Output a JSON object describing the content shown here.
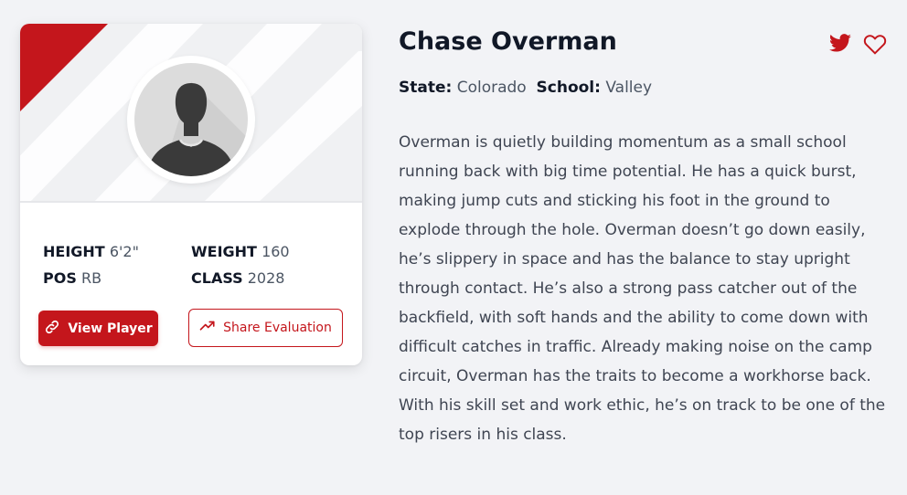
{
  "player": {
    "name": "Chase Overman",
    "state_label": "State:",
    "state": "Colorado",
    "school_label": "School:",
    "school": "Valley",
    "bio": "Overman is quietly building momentum as a small school running back with big time potential. He has a quick burst, making jump cuts and sticking his foot in the ground to explode through the hole. Overman doesn’t go down easily, he’s slippery in space and has the balance to stay upright through contact. He’s also a strong pass catcher out of the backfield, with soft hands and the ability to come down with difficult catches in traffic. Already making noise on the camp circuit, Overman has the traits to become a workhorse back. With his skill set and work ethic, he’s on track to be one of the top risers in his class."
  },
  "stats": {
    "height_label": "HEIGHT",
    "height": "6'2\"",
    "weight_label": "WEIGHT",
    "weight": "160",
    "pos_label": "POS",
    "pos": "RB",
    "class_label": "CLASS",
    "class": "2028"
  },
  "buttons": {
    "view_player": "View Player",
    "share_evaluation": "Share Evaluation"
  },
  "icons": {
    "view": "link-icon",
    "share": "trending-up-icon",
    "social": "twitter-icon",
    "favorite": "heart-outline-icon",
    "avatar": "person-silhouette-icon"
  },
  "colors": {
    "accent": "#c4161c",
    "text_dark": "#111827",
    "text_muted": "#4b5563",
    "background": "#f2f3f6"
  }
}
